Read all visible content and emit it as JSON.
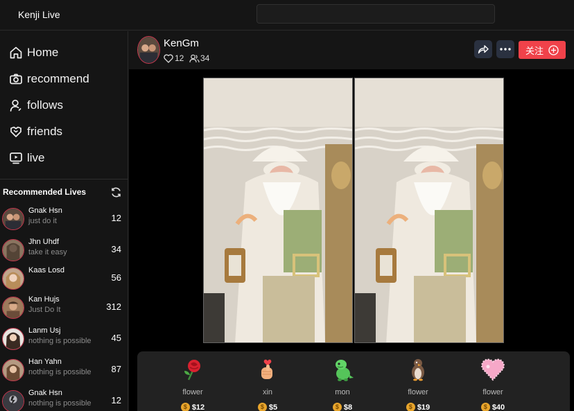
{
  "app": {
    "title": "Kenji Live"
  },
  "search": {
    "value": "",
    "placeholder": ""
  },
  "nav": {
    "items": [
      {
        "label": "Home",
        "icon": "home-icon"
      },
      {
        "label": "recommend",
        "icon": "camera-icon"
      },
      {
        "label": "follows",
        "icon": "user-icon"
      },
      {
        "label": "friends",
        "icon": "handshake-icon"
      },
      {
        "label": "live",
        "icon": "live-play-icon"
      }
    ]
  },
  "recommended": {
    "title": "Recommended Lives",
    "items": [
      {
        "name": "Gnak Hsn",
        "subtitle": "just do it",
        "count": "12"
      },
      {
        "name": "Jhn Uhdf",
        "subtitle": "take it easy",
        "count": "34"
      },
      {
        "name": "Kaas Losd",
        "subtitle": "",
        "count": "56"
      },
      {
        "name": "Kan Hujs",
        "subtitle": "Just Do It",
        "count": "312"
      },
      {
        "name": "Lanm Usj",
        "subtitle": "nothing is possible",
        "count": "45"
      },
      {
        "name": "Han Yahn",
        "subtitle": "nothing is possible",
        "count": "87"
      },
      {
        "name": "Gnak Hsn",
        "subtitle": "nothing is possible",
        "count": "12"
      }
    ]
  },
  "host": {
    "name": "KenGm",
    "likes": "12",
    "viewers": "34"
  },
  "actions": {
    "follow_label": "关注"
  },
  "colors": {
    "accent": "#f0424a",
    "avatar_ring": "#c8384f",
    "icon_button": "#2a3140",
    "coin": "#e8a52c"
  },
  "gifts": [
    {
      "name": "flower",
      "price": "$12",
      "icon": "rose-icon"
    },
    {
      "name": "xin",
      "price": "$5",
      "icon": "finger-heart-icon"
    },
    {
      "name": "mon",
      "price": "$8",
      "icon": "dinosaur-icon"
    },
    {
      "name": "flower",
      "price": "$19",
      "icon": "penguin-icon"
    },
    {
      "name": "flower",
      "price": "$40",
      "icon": "pink-heart-icon"
    }
  ]
}
